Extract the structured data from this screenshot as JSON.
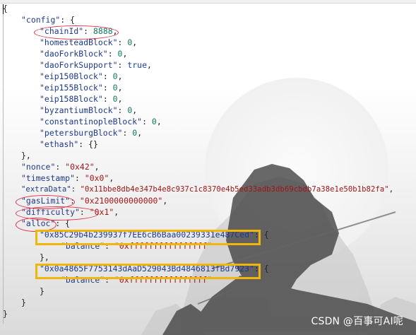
{
  "lines": [
    {
      "id": "l0",
      "parts": [
        "{"
      ]
    },
    {
      "id": "l1",
      "key": "\"config\"",
      "rest": ": {"
    },
    {
      "id": "l2",
      "key": "\"chainId\"",
      "rest": ": ",
      "val": "8888",
      "tail": ","
    },
    {
      "id": "l3",
      "key": "\"homesteadBlock\"",
      "rest": ": ",
      "val": "0",
      "tail": ","
    },
    {
      "id": "l4",
      "key": "\"daoForkBlock\"",
      "rest": ": ",
      "val": "0",
      "tail": ","
    },
    {
      "id": "l5",
      "key": "\"daoForkSupport\"",
      "rest": ": ",
      "val": "true",
      "tail": ","
    },
    {
      "id": "l6",
      "key": "\"eip150Block\"",
      "rest": ": ",
      "val": "0",
      "tail": ","
    },
    {
      "id": "l7",
      "key": "\"eip155Block\"",
      "rest": ": ",
      "val": "0",
      "tail": ","
    },
    {
      "id": "l8",
      "key": "\"eip158Block\"",
      "rest": ": ",
      "val": "0",
      "tail": ","
    },
    {
      "id": "l9",
      "key": "\"byzantiumBlock\"",
      "rest": ": ",
      "val": "0",
      "tail": ","
    },
    {
      "id": "l10",
      "key": "\"constantinopleBlock\"",
      "rest": ": ",
      "val": "0",
      "tail": ","
    },
    {
      "id": "l11",
      "key": "\"petersburgBlock\"",
      "rest": ": ",
      "val": "0",
      "tail": ","
    },
    {
      "id": "l12",
      "key": "\"ethash\"",
      "rest": ": {}"
    },
    {
      "id": "l13",
      "parts": [
        "},"
      ]
    },
    {
      "id": "l14",
      "key": "\"nonce\"",
      "rest": ": ",
      "str": "\"0x42\"",
      "tail": ","
    },
    {
      "id": "l15",
      "key": "\"timestamp\"",
      "rest": ": ",
      "str": "\"0x0\"",
      "tail": ","
    },
    {
      "id": "l16",
      "key": "\"extraData\"",
      "rest": ": ",
      "str": "\"0x11bbe8db4e347b4e8c937c1c8370e4b5ed33adb3db69cbdb7a38e1e50b1b82fa\"",
      "tail": ","
    },
    {
      "id": "l17",
      "key": "\"gasLimit\"",
      "rest": ": ",
      "str": "\"0x2100000000000\"",
      "tail": ","
    },
    {
      "id": "l18",
      "key": "\"difficulty\"",
      "rest": ": ",
      "str": "\"0x1\"",
      "tail": ","
    },
    {
      "id": "l19",
      "key": "\"alloc\"",
      "rest": ": {"
    },
    {
      "id": "l20",
      "key": "\"0x85C29b4b239937f7EE6cB6Baa00239331e487Ced\"",
      "rest": ": {"
    },
    {
      "id": "l21",
      "key": "\"balance\"",
      "rest": ": ",
      "str": "\"0xffffffffffffffff\""
    },
    {
      "id": "l22",
      "parts": [
        "},"
      ]
    },
    {
      "id": "l23",
      "key": "\"0x0a4865F7753143dAaD529043Bd4846813fBd7923\"",
      "rest": ": {"
    },
    {
      "id": "l24",
      "key": "\"balance\"",
      "rest": ": ",
      "str": "\"0xffffffffffffffff\""
    },
    {
      "id": "l25",
      "parts": [
        "}"
      ]
    },
    {
      "id": "l26",
      "parts": [
        "}"
      ]
    },
    {
      "id": "l27",
      "parts": [
        "}"
      ]
    }
  ],
  "watermark": "CSDN @百事可AI呢",
  "colors": {
    "key": "#1e3a8a",
    "string": "#a31515",
    "number": "#0b7a61",
    "highlight_ellipse": "#e0314b",
    "highlight_box": "#f2b50a"
  }
}
